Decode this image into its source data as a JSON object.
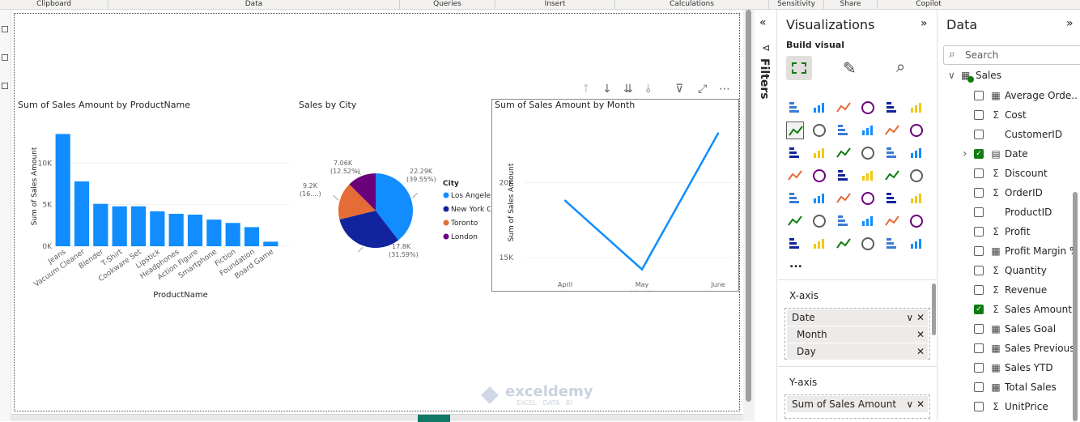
{
  "ribbon": {
    "groups": [
      "Clipboard",
      "Data",
      "Queries",
      "Insert",
      "Calculations",
      "Sensitivity",
      "Share",
      "Copilot"
    ]
  },
  "bar_chart": {
    "title": "Sum of Sales Amount by ProductName",
    "xlabel": "ProductName",
    "ylabel": "Sum of Sales Amount"
  },
  "pie_chart": {
    "title": "Sales by City",
    "legend_title": "City",
    "labels": [
      {
        "value": "22.29K",
        "pct": "(39.55%)"
      },
      {
        "value": "17.8K",
        "pct": "(31.59%)"
      },
      {
        "value": "9.2K",
        "pct": "(16....)"
      },
      {
        "value": "7.06K",
        "pct": "(12.52%)"
      }
    ]
  },
  "line_chart": {
    "title": "Sum of Sales Amount by Month",
    "xlabel": "Month",
    "ylabel": "Sum of Sales Amount"
  },
  "chart_data": [
    {
      "type": "bar",
      "title": "Sum of Sales Amount by ProductName",
      "xlabel": "ProductName",
      "ylabel": "Sum of Sales Amount",
      "categories": [
        "Jeans",
        "Vacuum Cleaner",
        "Blender",
        "T-Shirt",
        "Cookware Set",
        "Lipstick",
        "Headphones",
        "Action Figure",
        "Smartphone",
        "Fiction",
        "Foundation",
        "Board Game"
      ],
      "values": [
        13500,
        7800,
        5100,
        4800,
        4800,
        4200,
        3900,
        3800,
        3200,
        2800,
        2300,
        550
      ],
      "yticks": [
        "0K",
        "5K",
        "10K"
      ],
      "ylim": [
        0,
        15000
      ],
      "color": "#118dff"
    },
    {
      "type": "pie",
      "title": "Sales by City",
      "legend_title": "City",
      "categories": [
        "Los Angeles",
        "New York C...",
        "Toronto",
        "London"
      ],
      "values": [
        22290,
        17800,
        9200,
        7060
      ],
      "colors": [
        "#118dff",
        "#12239e",
        "#e66c37",
        "#6b007b"
      ]
    },
    {
      "type": "line",
      "title": "Sum of Sales Amount by Month",
      "xlabel": "Month",
      "ylabel": "Sum of Sales Amount",
      "categories": [
        "April",
        "May",
        "June"
      ],
      "values": [
        18800,
        14200,
        23300
      ],
      "yticks": [
        "15K",
        "20K"
      ],
      "ylim": [
        13800,
        24200
      ],
      "color": "#118dff"
    }
  ],
  "filters": {
    "label": "Filters"
  },
  "visualizations": {
    "title": "Visualizations",
    "build_visual": "Build visual",
    "more": "...",
    "xaxis_label": "X-axis",
    "xaxis_field": "Date",
    "xaxis_subfields": [
      "Month",
      "Day"
    ],
    "yaxis_label": "Y-axis",
    "yaxis_field": "Sum of Sales Amount"
  },
  "data_pane": {
    "title": "Data",
    "search_placeholder": "Search",
    "table_name": "Sales",
    "fields": [
      {
        "name": "Average Orde...",
        "icon": "calc",
        "checked": false
      },
      {
        "name": "Cost",
        "icon": "sigma",
        "checked": false
      },
      {
        "name": "CustomerID",
        "icon": "",
        "checked": false
      },
      {
        "name": "Date",
        "icon": "calendar",
        "checked": true
      },
      {
        "name": "Discount",
        "icon": "sigma",
        "checked": false
      },
      {
        "name": "OrderID",
        "icon": "sigma",
        "checked": false
      },
      {
        "name": "ProductID",
        "icon": "",
        "checked": false
      },
      {
        "name": "Profit",
        "icon": "sigma",
        "checked": false
      },
      {
        "name": "Profit Margin %",
        "icon": "calc",
        "checked": false
      },
      {
        "name": "Quantity",
        "icon": "sigma",
        "checked": false
      },
      {
        "name": "Revenue",
        "icon": "sigma",
        "checked": false
      },
      {
        "name": "Sales Amount",
        "icon": "sigma",
        "checked": true
      },
      {
        "name": "Sales Goal",
        "icon": "calc",
        "checked": false
      },
      {
        "name": "Sales Previous...",
        "icon": "calc",
        "checked": false
      },
      {
        "name": "Sales YTD",
        "icon": "calc",
        "checked": false
      },
      {
        "name": "Total Sales",
        "icon": "calc",
        "checked": false
      },
      {
        "name": "UnitPrice",
        "icon": "sigma",
        "checked": false
      }
    ]
  },
  "watermark": {
    "brand": "exceldemy",
    "tagline": "EXCEL · DATA · BI"
  },
  "colors": {
    "accent": "#118dff",
    "dark_blue": "#12239e",
    "orange": "#e66c37",
    "purple": "#6b007b",
    "checked": "#107c10"
  }
}
